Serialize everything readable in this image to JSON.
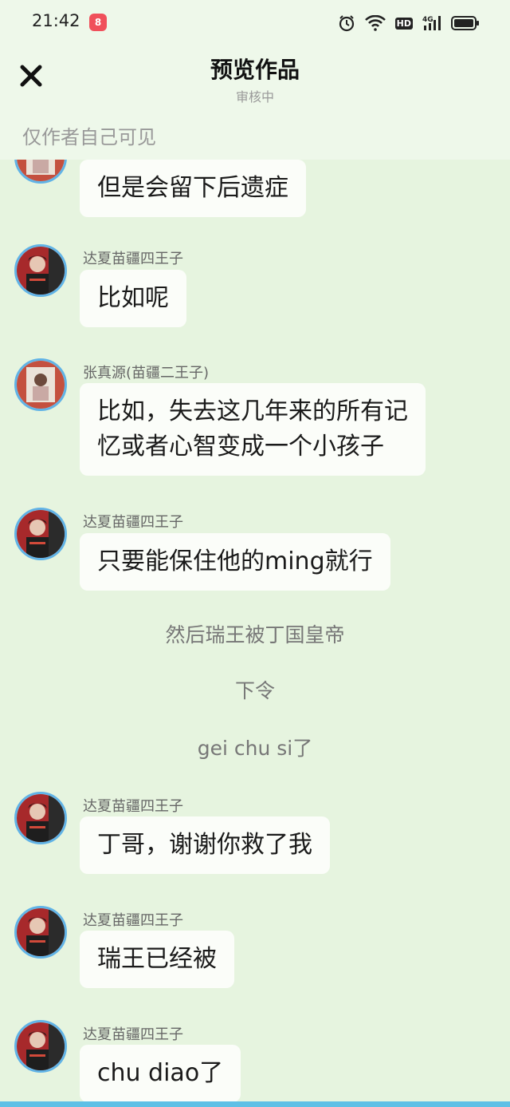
{
  "status_bar": {
    "time": "21:42",
    "app_icon": "kuaiying-app-icon",
    "right_icons": [
      "alarm-icon",
      "wifi-icon",
      "hd-icon",
      "signal-4g-icon",
      "battery-icon"
    ],
    "hd_label": "HD"
  },
  "header": {
    "close_icon": "close-icon",
    "title": "预览作品",
    "subtitle": "审核中",
    "visibility_note": "仅作者自己可见"
  },
  "colors": {
    "background": "#e6f4df",
    "header": "#eef8ea",
    "bubble": "#fbfdf9",
    "avatar_ring": "#61b3e6",
    "bottom_bar": "#5ec0e6"
  },
  "messages": [
    {
      "type": "bubble",
      "avatar": "zhang-avatar",
      "sender": "",
      "text": "但是会留下后遗症"
    },
    {
      "type": "bubble",
      "avatar": "prince-avatar",
      "sender": "达夏苗疆四王子",
      "text": "比如呢"
    },
    {
      "type": "bubble",
      "avatar": "zhang-avatar",
      "sender": "张真源(苗疆二王子)",
      "lines": [
        "比如，失去这几年来的所有记",
        "忆或者心智变成一个小孩子"
      ]
    },
    {
      "type": "bubble",
      "avatar": "prince-avatar",
      "sender": "达夏苗疆四王子",
      "text": "只要能保住他的ming就行"
    },
    {
      "type": "narration",
      "text": "然后瑞王被丁国皇帝"
    },
    {
      "type": "narration",
      "text": "下令"
    },
    {
      "type": "narration",
      "text": "gei chu si了"
    },
    {
      "type": "bubble",
      "avatar": "prince-avatar",
      "sender": "达夏苗疆四王子",
      "text": "丁哥，谢谢你救了我"
    },
    {
      "type": "bubble",
      "avatar": "prince-avatar",
      "sender": "达夏苗疆四王子",
      "text": "瑞王已经被"
    },
    {
      "type": "bubble",
      "avatar": "prince-avatar",
      "sender": "达夏苗疆四王子",
      "text": "chu diao了"
    }
  ]
}
